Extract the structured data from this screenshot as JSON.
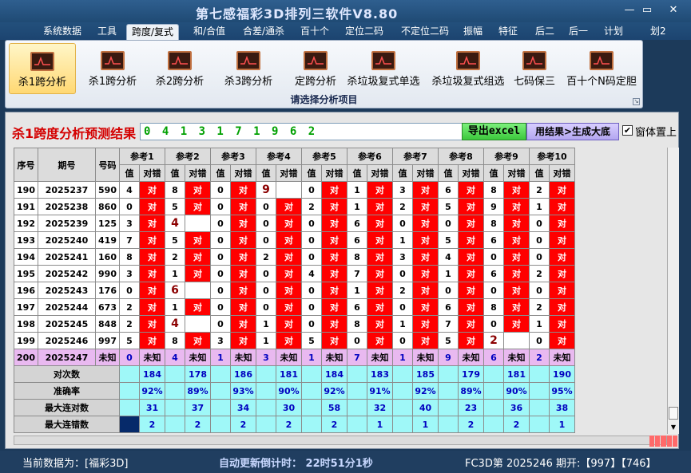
{
  "app": {
    "title": "第七感福彩3D排列三软件V8.80"
  },
  "window_controls": {
    "minimize": "—",
    "restore": "▭",
    "close": "✕"
  },
  "menu": [
    {
      "label": "系统数据",
      "active": false
    },
    {
      "label": "工具",
      "active": false
    },
    {
      "label": "跨度/复式",
      "active": true
    },
    {
      "label": "和/合值",
      "active": false
    },
    {
      "label": "合差/通杀",
      "active": false
    },
    {
      "label": "百十个",
      "active": false
    },
    {
      "label": "定位二码",
      "active": false
    },
    {
      "label": "不定位二码",
      "active": false
    },
    {
      "label": "振幅",
      "active": false
    },
    {
      "label": "特征",
      "active": false
    },
    {
      "label": "后二",
      "active": false
    },
    {
      "label": "后一",
      "active": false
    },
    {
      "label": "计划",
      "active": false
    },
    {
      "label": "划2",
      "active": false
    }
  ],
  "ribbon": {
    "buttons": [
      {
        "label": "杀1跨分析",
        "selected": true,
        "icon": "chart-icon"
      },
      {
        "label": "杀1跨分析",
        "selected": false,
        "icon": "chart-icon"
      },
      {
        "label": "杀2跨分析",
        "selected": false,
        "icon": "chart-icon"
      },
      {
        "label": "杀3跨分析",
        "selected": false,
        "icon": "chart-icon"
      },
      {
        "label": "定跨分析",
        "selected": false,
        "icon": "chart-icon"
      },
      {
        "label": "杀垃圾复式单选",
        "selected": false,
        "icon": "chart-icon"
      },
      {
        "label": "杀垃圾复式组选",
        "selected": false,
        "icon": "chart-icon"
      },
      {
        "label": "七码保三",
        "selected": false,
        "icon": "chart-icon"
      },
      {
        "label": "百十个N码定胆",
        "selected": false,
        "icon": "chart-icon"
      }
    ],
    "group_label": "请选择分析项目"
  },
  "result": {
    "title": "杀1跨度分析预测结果",
    "value": "0 4 1 3 1 7 1 9 6 2",
    "export_label": "导出excel",
    "generate_label": "用结果>生成大底",
    "topmost_checked": true,
    "topmost_label": "窗体置上"
  },
  "grid": {
    "headers": {
      "seq": "序号",
      "period": "期号",
      "number": "号码",
      "value": "值",
      "verdict": "对错"
    },
    "refs": [
      "参考1",
      "参考2",
      "参考3",
      "参考4",
      "参考5",
      "参考6",
      "参考7",
      "参考8",
      "参考9",
      "参考10"
    ],
    "rows": [
      {
        "seq": "190",
        "period": "2025237",
        "num": "590",
        "cells": [
          [
            "4",
            "对"
          ],
          [
            "8",
            "对"
          ],
          [
            "0",
            "对"
          ],
          [
            "9",
            ""
          ],
          [
            "0",
            "对"
          ],
          [
            "1",
            "对"
          ],
          [
            "3",
            "对"
          ],
          [
            "6",
            "对"
          ],
          [
            "8",
            "对"
          ],
          [
            "2",
            "对"
          ]
        ]
      },
      {
        "seq": "191",
        "period": "2025238",
        "num": "860",
        "cells": [
          [
            "0",
            "对"
          ],
          [
            "5",
            "对"
          ],
          [
            "0",
            "对"
          ],
          [
            "0",
            "对"
          ],
          [
            "2",
            "对"
          ],
          [
            "1",
            "对"
          ],
          [
            "2",
            "对"
          ],
          [
            "5",
            "对"
          ],
          [
            "9",
            "对"
          ],
          [
            "1",
            "对"
          ]
        ]
      },
      {
        "seq": "192",
        "period": "2025239",
        "num": "125",
        "cells": [
          [
            "3",
            "对"
          ],
          [
            "4",
            ""
          ],
          [
            "0",
            "对"
          ],
          [
            "0",
            "对"
          ],
          [
            "0",
            "对"
          ],
          [
            "6",
            "对"
          ],
          [
            "0",
            "对"
          ],
          [
            "0",
            "对"
          ],
          [
            "8",
            "对"
          ],
          [
            "0",
            "对"
          ]
        ]
      },
      {
        "seq": "193",
        "period": "2025240",
        "num": "419",
        "cells": [
          [
            "7",
            "对"
          ],
          [
            "5",
            "对"
          ],
          [
            "0",
            "对"
          ],
          [
            "0",
            "对"
          ],
          [
            "0",
            "对"
          ],
          [
            "6",
            "对"
          ],
          [
            "1",
            "对"
          ],
          [
            "5",
            "对"
          ],
          [
            "6",
            "对"
          ],
          [
            "0",
            "对"
          ]
        ]
      },
      {
        "seq": "194",
        "period": "2025241",
        "num": "160",
        "cells": [
          [
            "8",
            "对"
          ],
          [
            "2",
            "对"
          ],
          [
            "0",
            "对"
          ],
          [
            "2",
            "对"
          ],
          [
            "0",
            "对"
          ],
          [
            "8",
            "对"
          ],
          [
            "3",
            "对"
          ],
          [
            "4",
            "对"
          ],
          [
            "0",
            "对"
          ],
          [
            "0",
            "对"
          ]
        ]
      },
      {
        "seq": "195",
        "period": "2025242",
        "num": "990",
        "cells": [
          [
            "3",
            "对"
          ],
          [
            "1",
            "对"
          ],
          [
            "0",
            "对"
          ],
          [
            "0",
            "对"
          ],
          [
            "4",
            "对"
          ],
          [
            "7",
            "对"
          ],
          [
            "0",
            "对"
          ],
          [
            "1",
            "对"
          ],
          [
            "6",
            "对"
          ],
          [
            "2",
            "对"
          ]
        ]
      },
      {
        "seq": "196",
        "period": "2025243",
        "num": "176",
        "cells": [
          [
            "0",
            "对"
          ],
          [
            "6",
            ""
          ],
          [
            "0",
            "对"
          ],
          [
            "0",
            "对"
          ],
          [
            "0",
            "对"
          ],
          [
            "1",
            "对"
          ],
          [
            "2",
            "对"
          ],
          [
            "0",
            "对"
          ],
          [
            "0",
            "对"
          ],
          [
            "0",
            "对"
          ]
        ]
      },
      {
        "seq": "197",
        "period": "2025244",
        "num": "673",
        "cells": [
          [
            "2",
            "对"
          ],
          [
            "1",
            "对"
          ],
          [
            "0",
            "对"
          ],
          [
            "0",
            "对"
          ],
          [
            "0",
            "对"
          ],
          [
            "6",
            "对"
          ],
          [
            "0",
            "对"
          ],
          [
            "6",
            "对"
          ],
          [
            "8",
            "对"
          ],
          [
            "2",
            "对"
          ]
        ]
      },
      {
        "seq": "198",
        "period": "2025245",
        "num": "848",
        "cells": [
          [
            "2",
            "对"
          ],
          [
            "4",
            ""
          ],
          [
            "0",
            "对"
          ],
          [
            "1",
            "对"
          ],
          [
            "0",
            "对"
          ],
          [
            "8",
            "对"
          ],
          [
            "1",
            "对"
          ],
          [
            "7",
            "对"
          ],
          [
            "0",
            "对"
          ],
          [
            "1",
            "对"
          ]
        ]
      },
      {
        "seq": "199",
        "period": "2025246",
        "num": "997",
        "cells": [
          [
            "5",
            "对"
          ],
          [
            "8",
            "对"
          ],
          [
            "3",
            "对"
          ],
          [
            "1",
            "对"
          ],
          [
            "5",
            "对"
          ],
          [
            "0",
            "对"
          ],
          [
            "0",
            "对"
          ],
          [
            "5",
            "对"
          ],
          [
            "2",
            ""
          ],
          [
            "0",
            "对"
          ]
        ]
      }
    ],
    "pending": {
      "seq": "200",
      "period": "2025247",
      "num": "未知",
      "cells": [
        [
          "0",
          "未知"
        ],
        [
          "4",
          "未知"
        ],
        [
          "1",
          "未知"
        ],
        [
          "3",
          "未知"
        ],
        [
          "1",
          "未知"
        ],
        [
          "7",
          "未知"
        ],
        [
          "1",
          "未知"
        ],
        [
          "9",
          "未知"
        ],
        [
          "6",
          "未知"
        ],
        [
          "2",
          "未知"
        ]
      ]
    },
    "stats": [
      {
        "label": "对次数",
        "values": [
          "184",
          "178",
          "186",
          "181",
          "184",
          "183",
          "185",
          "179",
          "181",
          "190"
        ]
      },
      {
        "label": "准确率",
        "values": [
          "92%",
          "89%",
          "93%",
          "90%",
          "92%",
          "91%",
          "92%",
          "89%",
          "90%",
          "95%"
        ]
      },
      {
        "label": "最大连对数",
        "values": [
          "31",
          "37",
          "34",
          "30",
          "58",
          "32",
          "40",
          "23",
          "36",
          "38"
        ]
      },
      {
        "label": "最大连错数",
        "values": [
          "2",
          "2",
          "2",
          "2",
          "2",
          "1",
          "1",
          "2",
          "2",
          "1"
        ]
      }
    ]
  },
  "status": {
    "data_label": "当前数据为：[福彩3D]",
    "countdown": "自动更新倒计时：  22时51分1秒",
    "period": "FC3D第 2025246 期开:【997】【746】"
  }
}
